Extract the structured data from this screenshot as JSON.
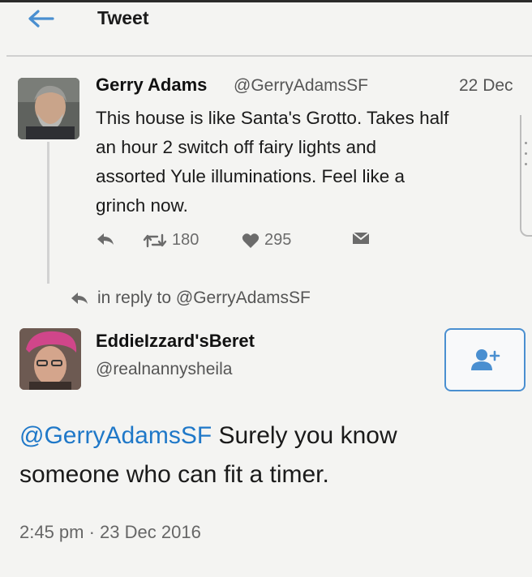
{
  "header": {
    "title": "Tweet"
  },
  "tweet": {
    "author_name": "Gerry Adams",
    "author_handle": "@GerryAdamsSF",
    "date": "22 Dec",
    "text_lines": [
      "This house is like Santa's Grotto. Takes half",
      "an hour 2 switch off fairy lights and",
      "assorted Yule illuminations. Feel like a",
      "grinch now."
    ],
    "retweets": "180",
    "likes": "295"
  },
  "reply": {
    "in_reply_to": "in reply to @GerryAdamsSF",
    "author_name": "EddieIzzard'sBeret",
    "author_handle": "@realnannysheila",
    "mention": "@GerryAdamsSF",
    "text_after_mention": " Surely you know",
    "text_line2": "someone who can fit a timer.",
    "timestamp": "2:45 pm · 23 Dec 2016"
  },
  "colors": {
    "accent": "#1f78c8",
    "background": "#f4f4f2",
    "follow_border": "#4a8fd0"
  },
  "icons": [
    "back-arrow-icon",
    "reply-icon",
    "retweet-icon",
    "heart-icon",
    "direct-message-icon",
    "follow-user-icon"
  ]
}
